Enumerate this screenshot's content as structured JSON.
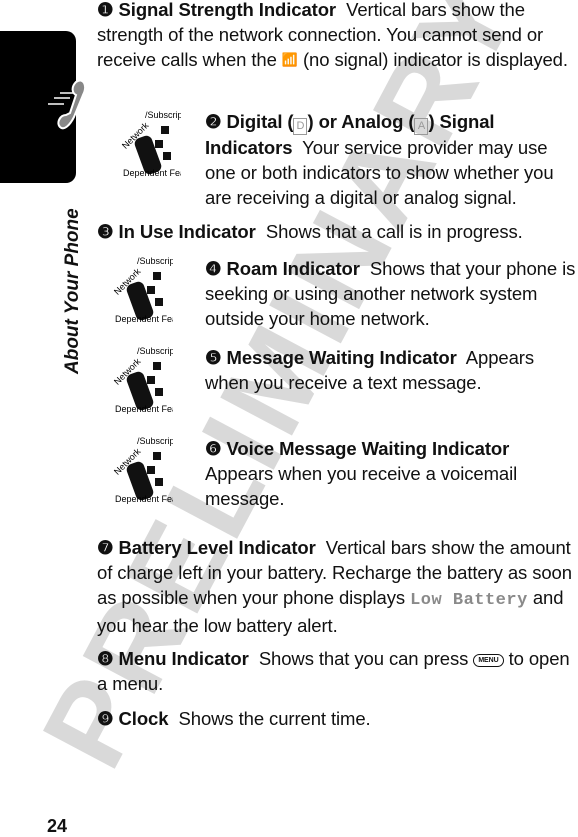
{
  "watermark": "PRELIMINARY",
  "section_tab": {
    "icon": "phone-handset-icon"
  },
  "side_title": "About Your Phone",
  "page_number": "24",
  "badge": {
    "top": "Network / Subscription",
    "bottom": "Dependent Feature"
  },
  "items": [
    {
      "num": "❶",
      "title": "Signal Strength Indicator",
      "text_a": "Vertical bars show the strength of the network connection. You cannot send or receive calls when the",
      "glyph": "no-signal-icon",
      "text_b": "(no signal) indicator is displayed."
    },
    {
      "num": "❷",
      "title_a": "Digital (",
      "glyph_d": "D",
      "title_b": ") or Analog (",
      "glyph_a": "A",
      "title_c": ") Signal Indicators",
      "text": "Your service provider may use one or both indicators to show whether you are receiving a digital or analog signal."
    },
    {
      "num": "❸",
      "title": "In Use Indicator",
      "text": "Shows that a call is in progress."
    },
    {
      "num": "❹",
      "title": "Roam Indicator",
      "text": "Shows that your phone is seeking or using another network system outside your home network."
    },
    {
      "num": "❺",
      "title": "Message Waiting Indicator",
      "text": "Appears when you receive a text message."
    },
    {
      "num": "❻",
      "title": "Voice Message Waiting Indicator",
      "text": "Appears when you receive a voicemail message."
    },
    {
      "num": "❼",
      "title": "Battery Level Indicator",
      "text_a": "Vertical bars show the amount of charge left in your battery. Recharge the battery as soon as possible when your phone displays",
      "display_text": "Low Battery",
      "text_b": "and you hear the low battery alert."
    },
    {
      "num": "❽",
      "title": "Menu Indicator",
      "text_a": "Shows that you can press",
      "key_label": "MENU",
      "text_b": "to open a menu."
    },
    {
      "num": "❾",
      "title": "Clock",
      "text": "Shows the current time."
    }
  ]
}
